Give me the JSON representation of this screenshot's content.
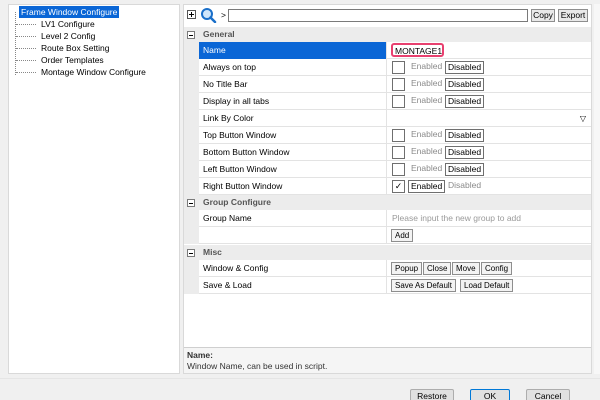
{
  "tree": {
    "items": [
      {
        "label": "Frame Window Configure",
        "selected": true
      },
      {
        "label": "LV1 Configure",
        "selected": false
      },
      {
        "label": "Level 2 Config",
        "selected": false
      },
      {
        "label": "Route Box Setting",
        "selected": false
      },
      {
        "label": "Order Templates",
        "selected": false
      },
      {
        "label": "Montage Window Configure",
        "selected": false
      }
    ]
  },
  "toolbar": {
    "path_prefix": ">",
    "copy_label": "Copy",
    "export_label": "Export"
  },
  "sections": {
    "general": "General",
    "group": "Group Configure",
    "misc": "Misc"
  },
  "rows": {
    "name": {
      "label": "Name",
      "value": "MONTAGE1"
    },
    "always_on_top": {
      "label": "Always on top",
      "enabled": "Enabled",
      "disabled": "Disabled"
    },
    "no_title_bar": {
      "label": "No Title Bar",
      "enabled": "Enabled",
      "disabled": "Disabled"
    },
    "display_all_tabs": {
      "label": "Display in all tabs",
      "enabled": "Enabled",
      "disabled": "Disabled"
    },
    "link_by_color": {
      "label": "Link By Color"
    },
    "top_button": {
      "label": "Top Button Window",
      "enabled": "Enabled",
      "disabled": "Disabled"
    },
    "bottom_button": {
      "label": "Bottom Button Window",
      "enabled": "Enabled",
      "disabled": "Disabled"
    },
    "left_button": {
      "label": "Left Button Window",
      "enabled": "Enabled",
      "disabled": "Disabled"
    },
    "right_button": {
      "label": "Right Button Window",
      "enabled": "Enabled",
      "disabled": "Disabled",
      "check": "✓"
    },
    "group_name": {
      "label": "Group Name",
      "placeholder": "Please input the new group to add"
    },
    "add": {
      "label": "Add"
    },
    "window_config": {
      "label": "Window & Config",
      "popup": "Popup",
      "close": "Close",
      "move": "Move",
      "config": "Config"
    },
    "save_load": {
      "label": "Save & Load",
      "save_default": "Save As Default",
      "load_default": "Load Default"
    }
  },
  "description": {
    "title": "Name:",
    "text": "Window Name, can be used in script."
  },
  "buttons": {
    "restore": "Restore",
    "ok": "OK",
    "cancel": "Cancel"
  },
  "colors": {
    "selection": "#0a66d6",
    "highlight": "#e8406f"
  }
}
